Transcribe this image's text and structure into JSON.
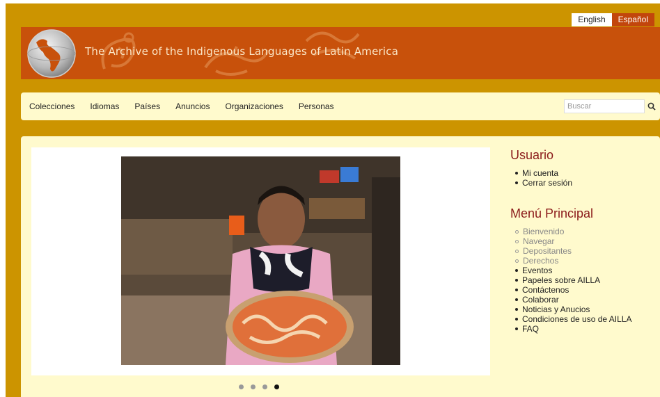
{
  "language_switch": {
    "english": "English",
    "spanish": "Español"
  },
  "header": {
    "site_title": "The Archive of the Indigenous Languages of Latin America"
  },
  "nav": {
    "items": [
      "Colecciones",
      "Idiomas",
      "Países",
      "Anuncios",
      "Organizaciones",
      "Personas"
    ],
    "search_placeholder": "Buscar"
  },
  "sidebar": {
    "user_block": {
      "title": "Usuario",
      "items": [
        "Mi cuenta",
        "Cerrar sesión"
      ]
    },
    "main_menu": {
      "title": "Menú Principal",
      "items": [
        "Bienvenido",
        "Navegar",
        "Depositantes",
        "Derechos",
        "Eventos",
        "Papeles sobre AILLA",
        "Contáctenos",
        "Colaborar",
        "Noticias y Anucios",
        "Condiciones de uso de AILLA",
        "FAQ"
      ]
    }
  },
  "slideshow": {
    "active_index": 3,
    "slide_count": 4
  },
  "colors": {
    "frame": "#cc9400",
    "banner": "#c8510b",
    "panel": "#fffacd",
    "heading": "#8b1a1a",
    "active_lang": "#c2460c"
  },
  "icons": {
    "search": "search-icon",
    "logo": "globe-logo"
  }
}
